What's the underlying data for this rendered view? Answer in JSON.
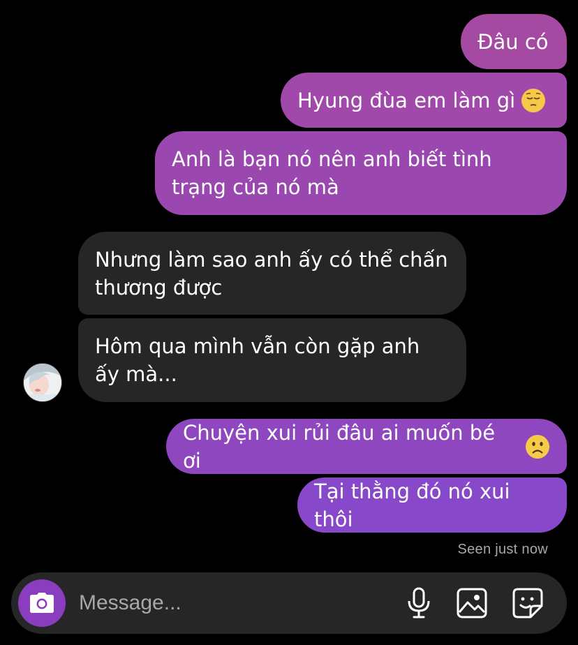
{
  "colors": {
    "outgoing_top": "#a24aa6",
    "outgoing_bottom": "#8a48c9",
    "incoming": "#262626",
    "accent_camera": "#8b3dbf"
  },
  "messages": {
    "m1": {
      "text": "Đâu có"
    },
    "m2": {
      "text": "Hyung đùa em làm gì",
      "emoji": "pensive-face-icon"
    },
    "m3": {
      "text": "Anh là bạn nó nên anh biết tình trạng của nó mà"
    },
    "m4": {
      "text": "Nhưng làm sao anh ấy có thể chấn thương được"
    },
    "m5": {
      "text": "Hôm qua mình vẫn còn gặp anh ấy mà..."
    },
    "m6": {
      "text": "Chuyện xui rủi đâu ai muốn bé ơi",
      "emoji": "frowning-face-icon"
    },
    "m7": {
      "text": "Tại thằng đó nó xui thôi"
    }
  },
  "seen_status": "Seen just now",
  "composer": {
    "placeholder": "Message...",
    "icons": [
      "camera-icon",
      "microphone-icon",
      "gallery-icon",
      "sticker-icon"
    ]
  }
}
